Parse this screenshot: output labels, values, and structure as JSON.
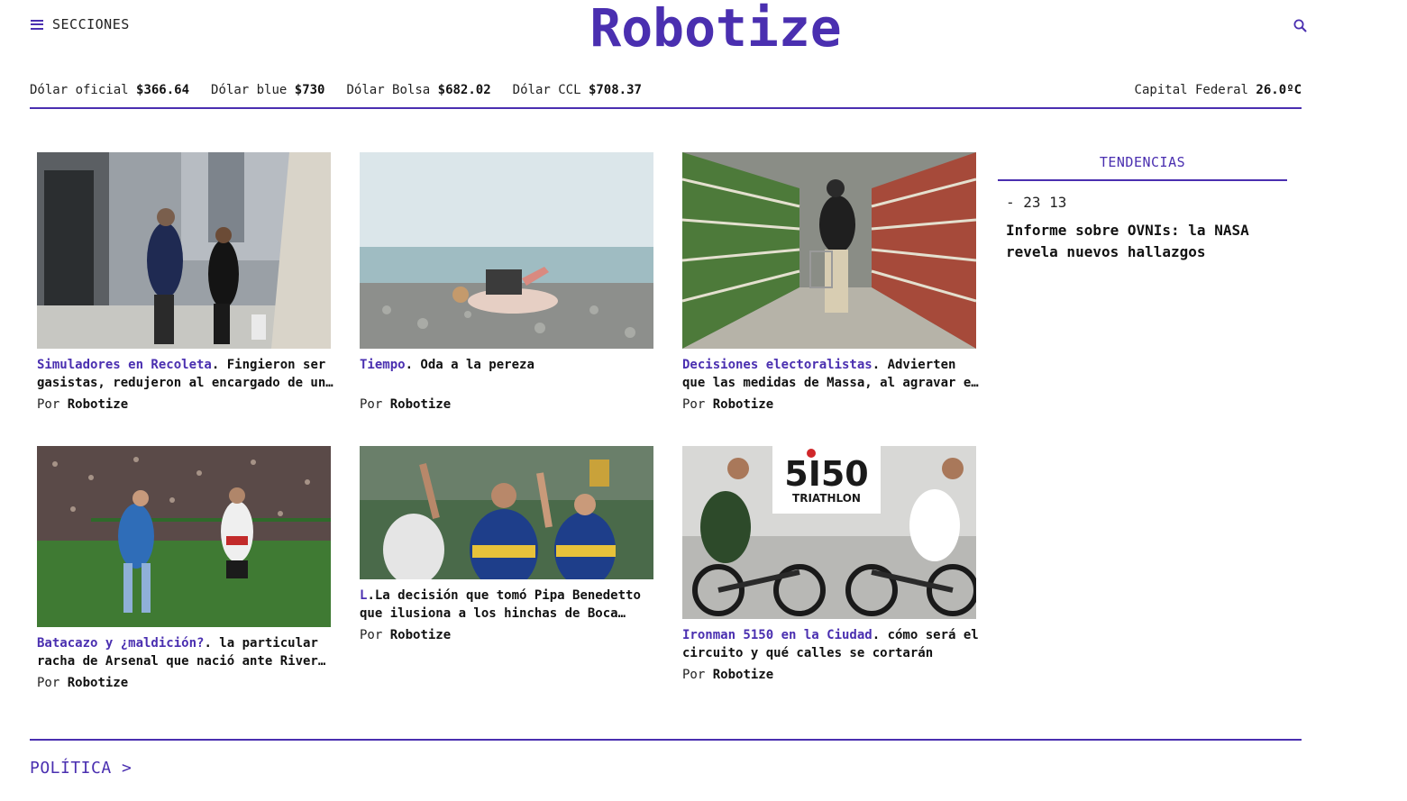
{
  "header": {
    "sections_label": "SECCIONES",
    "logo": "Robotize"
  },
  "ticker": {
    "items": [
      {
        "label": "Dólar oficial",
        "value": "$366.64"
      },
      {
        "label": "Dólar blue",
        "value": "$730"
      },
      {
        "label": "Dólar Bolsa",
        "value": "$682.02"
      },
      {
        "label": "Dólar CCL",
        "value": "$708.37"
      }
    ],
    "weather": {
      "label": "Capital Federal",
      "value": "26.0ºC"
    }
  },
  "articles": [
    {
      "kicker": "Simuladores en Recoleta",
      "text": ". Fingieron ser gasistas, redujeron al encargado de un edificio y robaron",
      "byline_prefix": "Por",
      "author": "Robotize",
      "image": "street-couple-photo"
    },
    {
      "kicker": "Tiempo",
      "text": ". Oda a la pereza",
      "byline_prefix": "Por",
      "author": "Robotize",
      "image": "beach-laptop-photo"
    },
    {
      "kicker": "Decisiones electoralistas",
      "text": ". Advierten que las medidas de Massa, al agravar el déficit",
      "byline_prefix": "Por",
      "author": "Robotize",
      "image": "supermarket-aisle-photo"
    },
    {
      "kicker": "Batacazo y ¿maldición?",
      "text": ". la particular racha de Arsenal que nació ante River en el Monumental",
      "byline_prefix": "Por",
      "author": "Robotize",
      "image": "football-players-photo"
    },
    {
      "kicker": "L",
      "text": ".La decisión que tomó Pipa Benedetto que ilusiona a los hinchas de Boca Juniors",
      "byline_prefix": "Por",
      "author": "Robotize",
      "image": "boca-celebration-photo"
    },
    {
      "kicker": "Ironman 5150 en la Ciudad",
      "text": ". cómo será el circuito y qué calles se cortarán",
      "byline_prefix": "Por",
      "author": "Robotize",
      "image": "triathlon-cyclists-photo"
    }
  ],
  "trends": {
    "title": "TENDENCIAS",
    "number": "- 23 13",
    "headline": "Informe sobre OVNIs: la NASA revela nuevos hallazgos"
  },
  "section": {
    "label": "POLÍTICA >"
  },
  "colors": {
    "accent": "#4a2fb0",
    "text": "#111111"
  }
}
